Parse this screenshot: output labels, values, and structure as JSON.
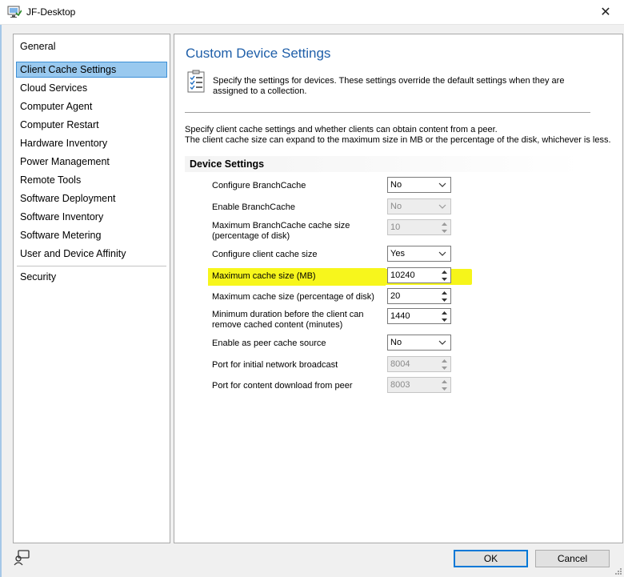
{
  "window": {
    "title": "JF-Desktop",
    "close_glyph": "✕"
  },
  "nav": {
    "items": [
      {
        "label": "General"
      },
      {
        "label": "Client Cache Settings"
      },
      {
        "label": "Cloud Services"
      },
      {
        "label": "Computer Agent"
      },
      {
        "label": "Computer Restart"
      },
      {
        "label": "Hardware Inventory"
      },
      {
        "label": "Power Management"
      },
      {
        "label": "Remote Tools"
      },
      {
        "label": "Software Deployment"
      },
      {
        "label": "Software Inventory"
      },
      {
        "label": "Software Metering"
      },
      {
        "label": "User and Device Affinity"
      },
      {
        "label": "Security"
      }
    ],
    "selected": "Client Cache Settings"
  },
  "main": {
    "title": "Custom Device Settings",
    "intro": "Specify the settings for devices. These settings override the default settings when they are assigned to a collection.",
    "desc_line1": "Specify client cache settings and whether clients can obtain content from a peer.",
    "desc_line2": "The client cache size can expand to the maximum size in MB or the percentage of the disk, whichever is less.",
    "section": "Device Settings",
    "settings": [
      {
        "label": "Configure BranchCache",
        "value": "No",
        "control": "select",
        "enabled": true
      },
      {
        "label": "Enable BranchCache",
        "value": "No",
        "control": "select",
        "enabled": false
      },
      {
        "label": "Maximum BranchCache cache size (percentage of disk)",
        "value": "10",
        "control": "spin",
        "enabled": false
      },
      {
        "label": "Configure client cache size",
        "value": "Yes",
        "control": "select",
        "enabled": true
      },
      {
        "label": "Maximum cache size (MB)",
        "value": "10240",
        "control": "spin",
        "enabled": true,
        "highlighted": true
      },
      {
        "label": "Maximum cache size (percentage of disk)",
        "value": "20",
        "control": "spin",
        "enabled": true
      },
      {
        "label": "Minimum duration before the client can remove cached content (minutes)",
        "value": "1440",
        "control": "spin",
        "enabled": true
      },
      {
        "label": "Enable as peer cache source",
        "value": "No",
        "control": "select",
        "enabled": true
      },
      {
        "label": "Port for initial network broadcast",
        "value": "8004",
        "control": "spin",
        "enabled": false
      },
      {
        "label": "Port for content download from peer",
        "value": "8003",
        "control": "spin",
        "enabled": false
      }
    ]
  },
  "footer": {
    "ok": "OK",
    "cancel": "Cancel"
  },
  "colors": {
    "accent": "#0078d7",
    "title_blue": "#1f5fa9",
    "selection": "#99c9ef",
    "highlight": "#f6f51a"
  },
  "icons": {
    "app": "device-settings-icon",
    "settings": "checklist-icon",
    "footer": "user-feedback-icon",
    "dropdown": "chevron-down-icon",
    "spin_up": "spin-up-icon",
    "spin_down": "spin-down-icon"
  }
}
